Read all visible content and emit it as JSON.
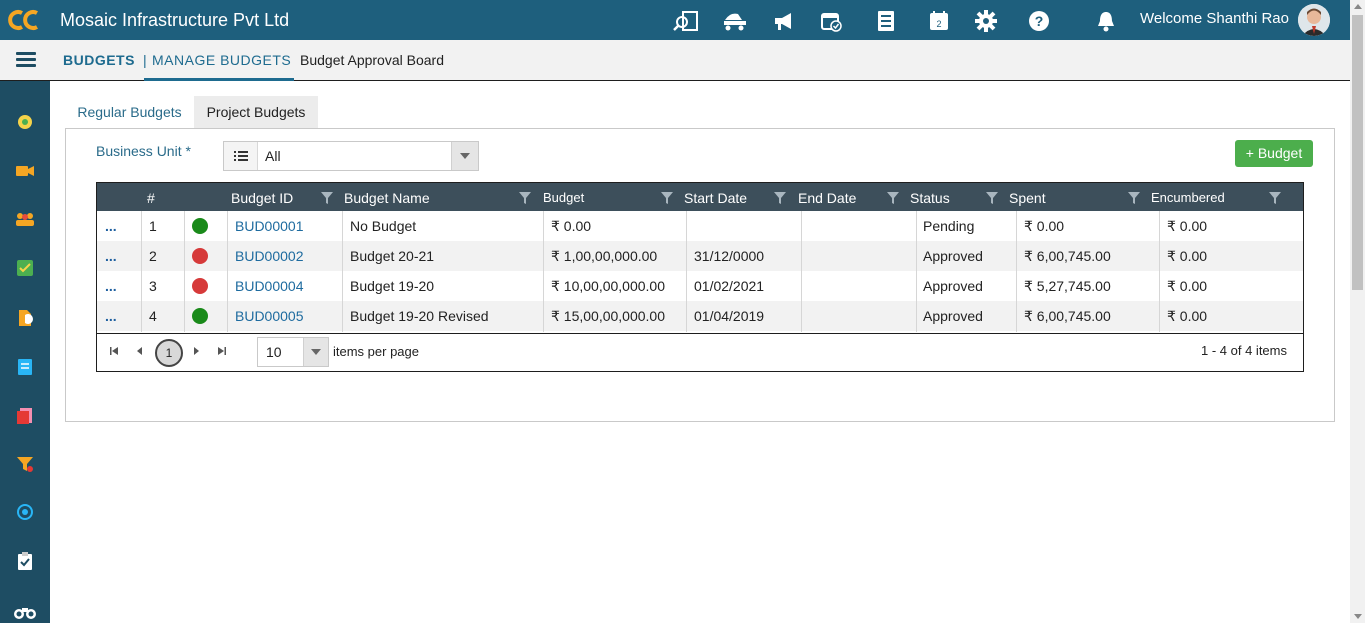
{
  "header": {
    "app_title": "Mosaic Infrastructure Pvt Ltd",
    "welcome": "Welcome Shanthi Rao",
    "icons": [
      "search-document-icon",
      "truck-icon",
      "megaphone-icon",
      "calendar-check-icon",
      "checklist-icon",
      "calendar-icon",
      "gear-icon",
      "help-icon",
      "bell-icon"
    ]
  },
  "breadcrumb": {
    "level1": "BUDGETS",
    "separator": "|",
    "level2": "MANAGE BUDGETS",
    "level3": "Budget Approval Board"
  },
  "sidebar": {
    "icons": [
      "dashboard-icon",
      "video-icon",
      "team-icon",
      "tasks-icon",
      "reports-icon",
      "notes-icon",
      "documents-icon",
      "filter-icon",
      "target-icon",
      "clipboard-icon",
      "binoculars-icon"
    ]
  },
  "tabs": [
    "Regular Budgets",
    "Project Budgets"
  ],
  "active_tab": "Regular Budgets",
  "filters": {
    "business_unit_label": "Business Unit *",
    "business_unit_value": "All"
  },
  "add_button": "+ Budget",
  "grid": {
    "columns": [
      "#",
      "Budget ID",
      "Budget Name",
      "Budget",
      "Start Date",
      "End Date",
      "Status",
      "Spent",
      "Encumbered"
    ],
    "rows": [
      {
        "menu": "...",
        "num": "1",
        "status_color": "#1a8a1a",
        "id": "BUD00001",
        "name": "No Budget",
        "budget": "₹ 0.00",
        "start": "",
        "end": "",
        "status": "Pending",
        "spent": "₹ 0.00",
        "encumbered": "₹ 0.00"
      },
      {
        "menu": "...",
        "num": "2",
        "status_color": "#d63a3a",
        "id": "BUD00002",
        "name": "Budget 20-21",
        "budget": "₹ 1,00,00,000.00",
        "start": "31/12/0000",
        "end": "",
        "status": "Approved",
        "spent": "₹ 6,00,745.00",
        "encumbered": "₹ 0.00"
      },
      {
        "menu": "...",
        "num": "3",
        "status_color": "#d63a3a",
        "id": "BUD00004",
        "name": "Budget 19-20",
        "budget": "₹ 10,00,00,000.00",
        "start": "01/02/2021",
        "end": "",
        "status": "Approved",
        "spent": "₹ 5,27,745.00",
        "encumbered": "₹ 0.00"
      },
      {
        "menu": "...",
        "num": "4",
        "status_color": "#1a8a1a",
        "id": "BUD00005",
        "name": "Budget 19-20 Revised",
        "budget": "₹ 15,00,00,000.00",
        "start": "01/04/2019",
        "end": "",
        "status": "Approved",
        "spent": "₹ 6,00,745.00",
        "encumbered": "₹ 0.00"
      }
    ]
  },
  "pager": {
    "current_page": "1",
    "page_size": "10",
    "items_per_page_label": "items per page",
    "info": "1 - 4 of 4 items"
  },
  "colors": {
    "topbar": "#1e5f7d",
    "sidebar": "#1e4d63",
    "grid_header": "#3d4f5b",
    "add_button": "#4cae4c",
    "approved_dot": "#d63a3a",
    "pending_dot": "#1a8a1a"
  }
}
